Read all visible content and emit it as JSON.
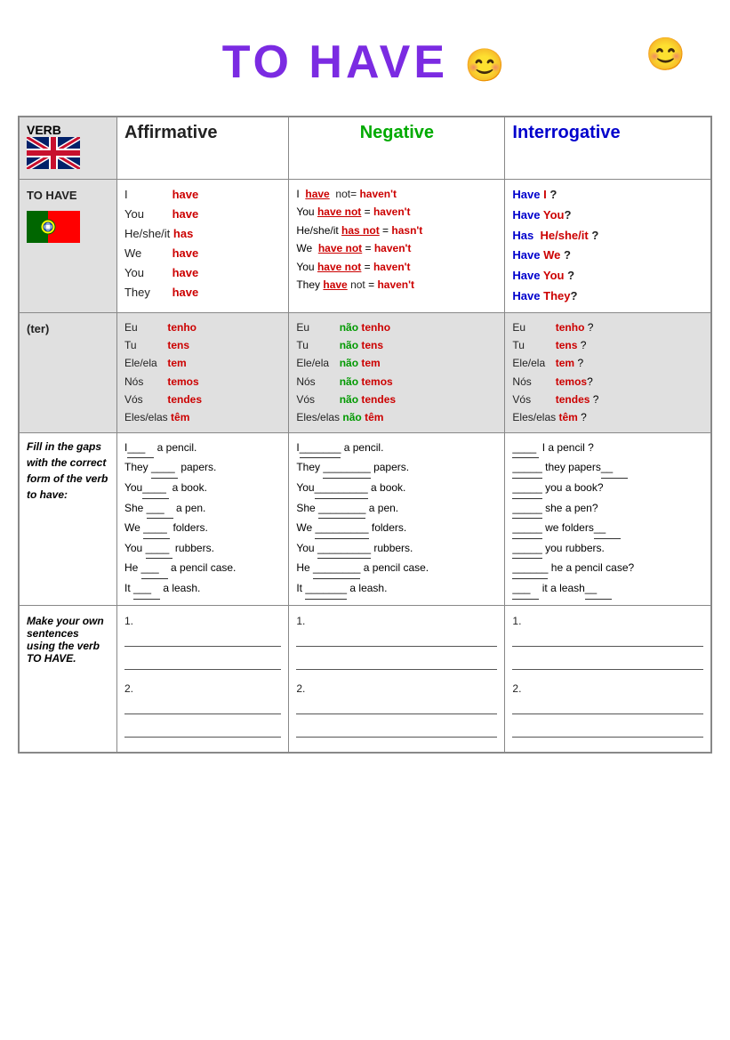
{
  "title": {
    "text": "TO HAVE",
    "emoji_mid": "😊",
    "emoji_corner": "😊"
  },
  "headers": {
    "verb": "VERB",
    "affirmative": "Affirmative",
    "negative": "Negative",
    "interrogative": "Interrogative"
  },
  "english": {
    "label": "TO HAVE",
    "affirmative": [
      {
        "subject": "I",
        "verb": "have"
      },
      {
        "subject": "You",
        "verb": "have"
      },
      {
        "subject": "He/she/it",
        "verb": "has"
      },
      {
        "subject": "We",
        "verb": "have"
      },
      {
        "subject": "You",
        "verb": "have"
      },
      {
        "subject": "They",
        "verb": "have"
      }
    ],
    "negative": [
      {
        "subject": "I",
        "verb": "have",
        "not": "not=",
        "contracted": "haven't"
      },
      {
        "subject": "You",
        "verb": "have",
        "not": "not",
        "contracted": "haven't"
      },
      {
        "subject": "He/she/it",
        "verb": "has",
        "not": "not",
        "contracted": "hasn't"
      },
      {
        "subject": "We",
        "verb": "have",
        "not": "not",
        "contracted": "haven't"
      },
      {
        "subject": "You",
        "verb": "have",
        "not": "not",
        "contracted": "haven't"
      },
      {
        "subject": "They",
        "verb": "have",
        "not": "not",
        "contracted": "haven't"
      }
    ],
    "interrogative": [
      {
        "aux": "Have",
        "subject": "I",
        "q": "?"
      },
      {
        "aux": "Have",
        "subject": "You",
        "q": "?"
      },
      {
        "aux": "Has",
        "subject": "He/she/it",
        "q": "?"
      },
      {
        "aux": "Have",
        "subject": "We",
        "q": "?"
      },
      {
        "aux": "Have",
        "subject": "You",
        "q": "?"
      },
      {
        "aux": "Have",
        "subject": "They",
        "q": "?"
      }
    ]
  },
  "portuguese": {
    "label": "(ter)",
    "affirmative": [
      {
        "subject": "Eu",
        "verb": "tenho"
      },
      {
        "subject": "Tu",
        "verb": "tens"
      },
      {
        "subject": "Ele/ela",
        "verb": "tem"
      },
      {
        "subject": "Nós",
        "verb": "temos"
      },
      {
        "subject": "Vós",
        "verb": "tendes"
      },
      {
        "subject": "Eles/elas",
        "verb": "têm"
      }
    ],
    "negative": [
      {
        "subject": "Eu",
        "neg": "não",
        "verb": "tenho"
      },
      {
        "subject": "Tu",
        "neg": "não",
        "verb": "tens"
      },
      {
        "subject": "Ele/ela",
        "neg": "não",
        "verb": "tem"
      },
      {
        "subject": "Nós",
        "neg": "não",
        "verb": "temos"
      },
      {
        "subject": "Vós",
        "neg": "não",
        "verb": "tendes"
      },
      {
        "subject": "Eles/elas",
        "neg": "não",
        "verb": "têm"
      }
    ],
    "interrogative": [
      {
        "subject": "Eu",
        "verb": "tenho",
        "q": "?"
      },
      {
        "subject": "Tu",
        "verb": "tens",
        "q": "?"
      },
      {
        "subject": "Ele/ela",
        "verb": "tem",
        "q": "?"
      },
      {
        "subject": "Nós",
        "verb": "temos",
        "q": "?"
      },
      {
        "subject": "Vós",
        "verb": "tendes",
        "q": "?"
      },
      {
        "subject": "Eles/elas",
        "verb": "têm",
        "q": "?"
      }
    ]
  },
  "fill_gaps": {
    "label": "Fill in the gaps with the correct form of the verb to have:",
    "affirmative": [
      "I___ a pencil.",
      "They ____ papers.",
      "You____ a book.",
      "She ___ a pen.",
      "We ____ folders.",
      "You ____ rubbers.",
      "He ___ a pencil case.",
      "It ___ a leash."
    ],
    "negative": [
      "I_______ a pencil.",
      "They ________ papers.",
      "You_________ a book.",
      "She ________ a pen.",
      "We _________ folders.",
      "You _________ rubbers.",
      "He ________ a pencil case.",
      "It _______ a leash."
    ],
    "interrogative": [
      "____ I a pencil ?",
      "_____ they papers__",
      "_____ you a book?",
      "_____ she a pen?",
      "_____ we folders__",
      "_____ you rubbers.",
      "______ he  a pencil case?",
      "___ it a leash__"
    ]
  },
  "make_sentences": {
    "label": "Make your own sentences using the verb TO HAVE.",
    "numbers": [
      "1.",
      "2."
    ]
  }
}
